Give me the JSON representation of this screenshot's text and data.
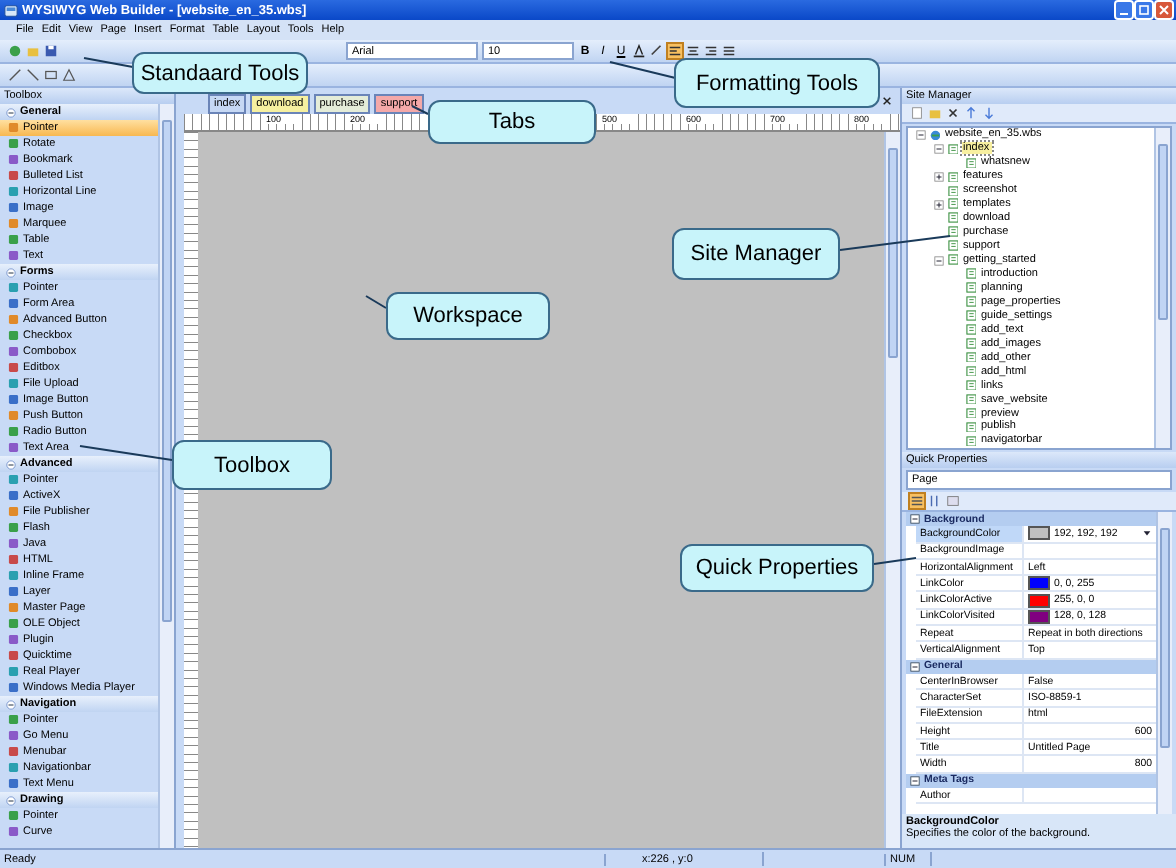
{
  "window": {
    "title": "WYSIWYG Web Builder - [website_en_35.wbs]"
  },
  "menu": [
    "File",
    "Edit",
    "View",
    "Page",
    "Insert",
    "Format",
    "Table",
    "Layout",
    "Tools",
    "Help"
  ],
  "format_toolbar": {
    "font": "Arial",
    "size": "10",
    "bold": "B",
    "italic": "I",
    "underline": "U"
  },
  "toolbox": {
    "title": "Toolbox",
    "groups": [
      {
        "name": "General",
        "expanded": true,
        "items": [
          {
            "label": "Pointer",
            "selected": true
          },
          {
            "label": "Rotate",
            "selected": false
          },
          {
            "label": "Bookmark",
            "selected": false
          },
          {
            "label": "Bulleted List",
            "selected": false
          },
          {
            "label": "Horizontal Line",
            "selected": false
          },
          {
            "label": "Image",
            "selected": false
          },
          {
            "label": "Marquee",
            "selected": false
          },
          {
            "label": "Table",
            "selected": false
          },
          {
            "label": "Text",
            "selected": false
          }
        ]
      },
      {
        "name": "Forms",
        "expanded": true,
        "items": [
          {
            "label": "Pointer",
            "selected": false
          },
          {
            "label": "Form Area",
            "selected": false
          },
          {
            "label": "Advanced Button",
            "selected": false
          },
          {
            "label": "Checkbox",
            "selected": false
          },
          {
            "label": "Combobox",
            "selected": false
          },
          {
            "label": "Editbox",
            "selected": false
          },
          {
            "label": "File Upload",
            "selected": false
          },
          {
            "label": "Image Button",
            "selected": false
          },
          {
            "label": "Push Button",
            "selected": false
          },
          {
            "label": "Radio Button",
            "selected": false
          },
          {
            "label": "Text Area",
            "selected": false
          }
        ]
      },
      {
        "name": "Advanced",
        "expanded": true,
        "items": [
          {
            "label": "Pointer",
            "selected": false
          },
          {
            "label": "ActiveX",
            "selected": false
          },
          {
            "label": "File Publisher",
            "selected": false
          },
          {
            "label": "Flash",
            "selected": false
          },
          {
            "label": "Java",
            "selected": false
          },
          {
            "label": "HTML",
            "selected": false
          },
          {
            "label": "Inline Frame",
            "selected": false
          },
          {
            "label": "Layer",
            "selected": false
          },
          {
            "label": "Master Page",
            "selected": false
          },
          {
            "label": "OLE Object",
            "selected": false
          },
          {
            "label": "Plugin",
            "selected": false
          },
          {
            "label": "Quicktime",
            "selected": false
          },
          {
            "label": "Real Player",
            "selected": false
          },
          {
            "label": "Windows Media Player",
            "selected": false
          }
        ]
      },
      {
        "name": "Navigation",
        "expanded": true,
        "items": [
          {
            "label": "Pointer",
            "selected": false
          },
          {
            "label": "Go Menu",
            "selected": false
          },
          {
            "label": "Menubar",
            "selected": false
          },
          {
            "label": "Navigationbar",
            "selected": false
          },
          {
            "label": "Text Menu",
            "selected": false
          }
        ]
      },
      {
        "name": "Drawing",
        "expanded": true,
        "items": [
          {
            "label": "Pointer",
            "selected": false
          },
          {
            "label": "Curve",
            "selected": false
          }
        ]
      }
    ]
  },
  "tabs": [
    {
      "label": "index",
      "color": "#c6d8f4"
    },
    {
      "label": "download",
      "color": "#f6f0a0"
    },
    {
      "label": "purchase",
      "color": "#e4ecd8"
    },
    {
      "label": "support",
      "color": "#f4a8a8"
    }
  ],
  "ruler_labels": [
    "100",
    "200",
    "500",
    "600",
    "700",
    "800"
  ],
  "site_manager": {
    "title": "Site Manager",
    "tree": [
      {
        "label": "website_en_35.wbs",
        "kind": "site",
        "selected": false,
        "expanded": true,
        "children": [
          {
            "label": "index",
            "kind": "page",
            "selected": true,
            "expanded": true,
            "children": [
              {
                "label": "whatsnew",
                "kind": "page",
                "selected": false
              }
            ]
          },
          {
            "label": "features",
            "kind": "page",
            "selected": false,
            "expanded": false
          },
          {
            "label": "screenshot",
            "kind": "page",
            "selected": false
          },
          {
            "label": "templates",
            "kind": "page",
            "selected": false,
            "expanded": false
          },
          {
            "label": "download",
            "kind": "page",
            "selected": false
          },
          {
            "label": "purchase",
            "kind": "page",
            "selected": false
          },
          {
            "label": "support",
            "kind": "page",
            "selected": false
          },
          {
            "label": "getting_started",
            "kind": "page",
            "selected": false,
            "expanded": true,
            "children": [
              {
                "label": "introduction",
                "kind": "page",
                "selected": false
              },
              {
                "label": "planning",
                "kind": "page",
                "selected": false
              },
              {
                "label": "page_properties",
                "kind": "page",
                "selected": false
              },
              {
                "label": "guide_settings",
                "kind": "page",
                "selected": false
              },
              {
                "label": "add_text",
                "kind": "page",
                "selected": false
              },
              {
                "label": "add_images",
                "kind": "page",
                "selected": false
              },
              {
                "label": "add_other",
                "kind": "page",
                "selected": false
              },
              {
                "label": "add_html",
                "kind": "page",
                "selected": false
              },
              {
                "label": "links",
                "kind": "page",
                "selected": false
              },
              {
                "label": "save_website",
                "kind": "page",
                "selected": false
              },
              {
                "label": "preview",
                "kind": "page",
                "selected": false
              },
              {
                "label": "publish",
                "kind": "page",
                "selected": false
              },
              {
                "label": "navigatorbar",
                "kind": "page",
                "selected": false
              }
            ]
          }
        ]
      }
    ]
  },
  "quick_properties": {
    "title": "Quick Properties",
    "object": "Page",
    "categories": [
      {
        "name": "Background",
        "expanded": true,
        "rows": [
          {
            "name": "BackgroundColor",
            "value": "192, 192, 192",
            "kind": "color",
            "color": "#c0c0c0",
            "selected": true
          },
          {
            "name": "BackgroundImage",
            "value": "",
            "kind": "text",
            "selected": false
          },
          {
            "name": "HorizontalAlignment",
            "value": "Left",
            "kind": "text",
            "selected": false
          },
          {
            "name": "LinkColor",
            "value": "0, 0, 255",
            "kind": "color",
            "color": "#0000ff",
            "selected": false
          },
          {
            "name": "LinkColorActive",
            "value": "255, 0, 0",
            "kind": "color",
            "color": "#ff0000",
            "selected": false
          },
          {
            "name": "LinkColorVisited",
            "value": "128, 0, 128",
            "kind": "color",
            "color": "#800080",
            "selected": false
          },
          {
            "name": "Repeat",
            "value": "Repeat in both directions",
            "kind": "text",
            "selected": false
          },
          {
            "name": "VerticalAlignment",
            "value": "Top",
            "kind": "text",
            "selected": false
          }
        ]
      },
      {
        "name": "General",
        "expanded": true,
        "rows": [
          {
            "name": "CenterInBrowser",
            "value": "False",
            "kind": "text",
            "selected": false
          },
          {
            "name": "CharacterSet",
            "value": "ISO-8859-1",
            "kind": "text",
            "selected": false
          },
          {
            "name": "FileExtension",
            "value": "html",
            "kind": "text",
            "selected": false
          },
          {
            "name": "Height",
            "value": "600",
            "kind": "number",
            "selected": false
          },
          {
            "name": "Title",
            "value": "Untitled Page",
            "kind": "text",
            "selected": false
          },
          {
            "name": "Width",
            "value": "800",
            "kind": "number",
            "selected": false
          }
        ]
      },
      {
        "name": "Meta Tags",
        "expanded": true,
        "rows": [
          {
            "name": "Author",
            "value": "",
            "kind": "text",
            "selected": false
          }
        ]
      }
    ],
    "description": {
      "title": "BackgroundColor",
      "text": "Specifies the color of the background."
    }
  },
  "status_bar": {
    "message": "Ready",
    "position": "x:226 , y:0",
    "num": "NUM"
  },
  "callouts": [
    {
      "text": "Standaard Tools"
    },
    {
      "text": "Tabs"
    },
    {
      "text": "Formatting Tools"
    },
    {
      "text": "Site Manager"
    },
    {
      "text": "Workspace"
    },
    {
      "text": "Toolbox"
    },
    {
      "text": "Quick Properties"
    }
  ]
}
